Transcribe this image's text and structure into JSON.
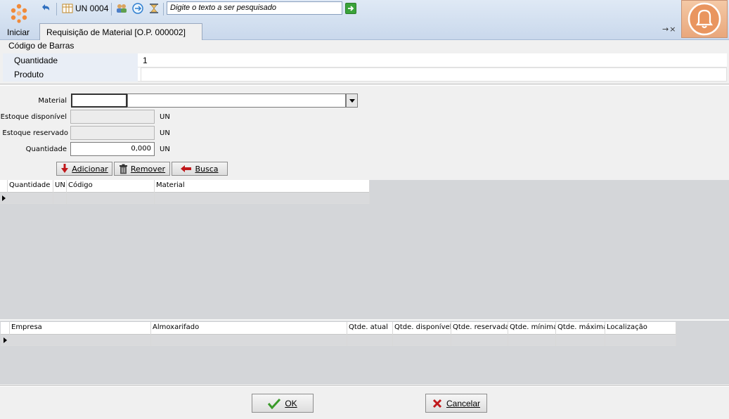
{
  "toolbar": {
    "start_label": "Iniciar",
    "unit_label": "UN 0004",
    "search_placeholder": "Digite o texto a ser pesquisado"
  },
  "tab": {
    "title": "Requisição de Material [O.P. 000002]",
    "controls": "→×"
  },
  "barcode": {
    "title": "Código de Barras",
    "rows": [
      {
        "label": "Quantidade",
        "value": "1"
      },
      {
        "label": "Produto",
        "value": ""
      }
    ]
  },
  "form": {
    "material_label": "Material",
    "material_code": "",
    "material_name": "",
    "estoque_disponivel_label": "Estoque disponível",
    "estoque_disponivel_value": "",
    "estoque_reservado_label": "Estoque reservado",
    "estoque_reservado_value": "",
    "quantidade_label": "Quantidade",
    "quantidade_value": "0,000",
    "unit": "UN"
  },
  "actions": {
    "add_label": "Adicionar",
    "remove_label": "Remover",
    "search_label": "Busca"
  },
  "grid_materials": {
    "columns": [
      "Quantidade",
      "UN",
      "Código",
      "Material"
    ]
  },
  "grid_stock": {
    "columns": [
      "Empresa",
      "Almoxarifado",
      "Qtde. atual",
      "Qtde. disponível",
      "Qtde. reservada",
      "Qtde. mínima",
      "Qtde. máxima",
      "Localização"
    ]
  },
  "footer": {
    "ok_label": "OK",
    "cancel_label": "Cancelar"
  },
  "colors": {
    "toolbar": "#c9d8ec",
    "bell_bg": "#e9a77c",
    "grid_bg": "#d4d6d9",
    "ok_check": "#3a9a2a",
    "cancel_x": "#c0181b"
  }
}
